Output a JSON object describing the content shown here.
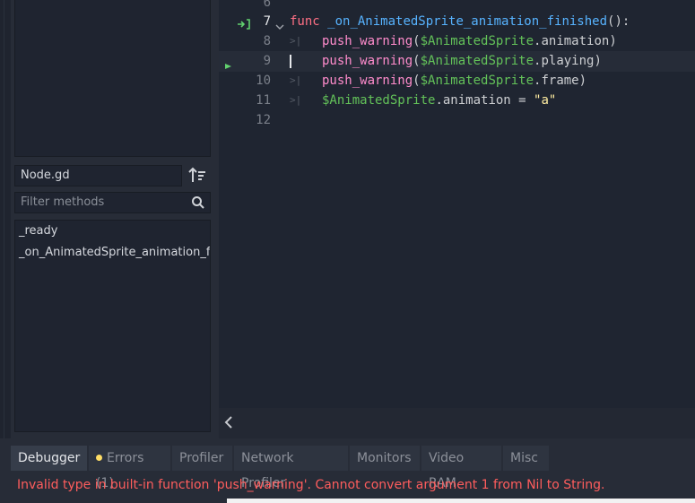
{
  "left_panel": {
    "script_name": "Node.gd",
    "filter_placeholder": "Filter methods",
    "methods": [
      "_ready",
      "_on_AnimatedSprite_animation_finished"
    ]
  },
  "editor": {
    "lines": [
      {
        "num": "6"
      },
      {
        "num": "7"
      },
      {
        "num": "8"
      },
      {
        "num": "9"
      },
      {
        "num": "10"
      },
      {
        "num": "11"
      },
      {
        "num": "12"
      }
    ],
    "code": {
      "l7_kw": "func",
      "l7_fn": "_on_AnimatedSprite_animation_finished",
      "l7_rest": "():",
      "pw": "push_warning",
      "open": "(",
      "node": "$AnimatedSprite",
      "l8_prop": ".animation)",
      "l9_prop": ".playing)",
      "l10_prop": ".frame)",
      "l11_prop": ".animation",
      "l11_eq": " = ",
      "l11_str": "\"a\""
    }
  },
  "bottom_panel": {
    "tabs": [
      "Debugger",
      "Errors (1)",
      "Profiler",
      "Network Profiler",
      "Monitors",
      "Video RAM",
      "Misc"
    ],
    "active_tab": "Debugger",
    "error_message": "Invalid type in built-in function 'push_warning'. Cannot convert argument 1 from Nil to String."
  },
  "colors": {
    "keyword": "#ff7085",
    "function_name": "#57b3ff",
    "builtin": "#ff8ccc",
    "node_path": "#63c259",
    "string": "#ffeda1",
    "error": "#ff5d5d",
    "warning_dot": "#ffdd65"
  },
  "icons": [
    "sort-icon",
    "search-icon",
    "connection-slot-icon",
    "fold-arrow-icon",
    "breakpoint-arrow-icon",
    "tab-indent-icon",
    "collapse-left-icon"
  ]
}
